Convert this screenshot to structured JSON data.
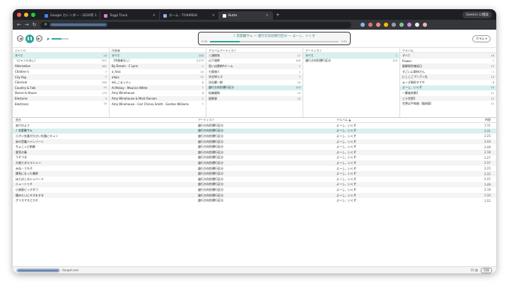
{
  "tabs": [
    {
      "label": "Google カレンダー - 2026年 1",
      "color": "#4285f4",
      "active": false
    },
    {
      "label": "Toggl Track",
      "color": "#e57cd8",
      "active": false
    },
    {
      "label": "ホーム - TOKIMEKI",
      "color": "#8ab4f8",
      "active": false
    },
    {
      "label": "Butte",
      "color": "#ffffff",
      "active": true
    }
  ],
  "profile": "Gemini に相談",
  "player": {
    "now_playing": "♪ 恋愛離サム ー 盛行方向別運行区分 ー よーし、いくぞ",
    "elapsed": "0:35",
    "duration": "2:31",
    "progress": 0.23,
    "volume": 0.6,
    "column_button": "カラム ▾"
  },
  "panes": [
    {
      "header": "ジャンル",
      "items": [
        {
          "label": "すべて",
          "count": "24",
          "sel": true
        },
        {
          "label": "（ジャンルなし）",
          "count": "501"
        },
        {
          "label": "Alternative",
          "count": "281"
        },
        {
          "label": "Children's",
          "count": "7"
        },
        {
          "label": "City Pop",
          "count": "1"
        },
        {
          "label": "Classical",
          "count": "290"
        },
        {
          "label": "Country & Folk",
          "count": "11"
        },
        {
          "label": "Dance & House",
          "count": "173"
        },
        {
          "label": "Electonic",
          "count": "9"
        },
        {
          "label": "Electronic",
          "count": "19"
        }
      ]
    },
    {
      "header": "作曲者",
      "items": [
        {
          "label": "すべて",
          "count": "285",
          "sel": true
        },
        {
          "label": "（作曲者なし）",
          "count": "3,279"
        },
        {
          "label": "By Dream - C Lynn",
          "count": "1"
        },
        {
          "label": "a_hisa",
          "count": "10"
        },
        {
          "label": "a%ks",
          "count": "12"
        },
        {
          "label": "aki_こまっティ",
          "count": "6"
        },
        {
          "label": "Al Mckay - Maurice White",
          "count": "1"
        },
        {
          "label": "Amy Winehouse",
          "count": "8"
        },
        {
          "label": "Amy Winehouse & Mark Ronson",
          "count": "1"
        },
        {
          "label": "Amy Winehouse - Carl Chinna Smith - Gordon Williams",
          "count": "1"
        }
      ]
    },
    {
      "header": "アルバムアーティスト",
      "items": [
        {
          "label": "三浦徳和",
          "count": "17"
        },
        {
          "label": "山下達郎",
          "count": "146"
        },
        {
          "label": "思い出野郎Aチーム",
          "count": "1"
        },
        {
          "label": "七尾旅人",
          "count": "1"
        },
        {
          "label": "渋谷知らズ",
          "count": "7"
        },
        {
          "label": "渋谷慶一郎",
          "count": "14"
        },
        {
          "label": "盛行方向別運行区分",
          "count": "124",
          "sel": true
        },
        {
          "label": "松森優和",
          "count": "14"
        },
        {
          "label": "星野源",
          "count": "15"
        }
      ]
    },
    {
      "header": "アーティスト",
      "items": [
        {
          "label": "すべて",
          "count": "1",
          "sel": true
        },
        {
          "label": "盛行方向別運行区分",
          "count": "124"
        }
      ]
    },
    {
      "header": "アルバム",
      "items": [
        {
          "label": "すべて",
          "count": "18"
        },
        {
          "label": "Flower",
          "count": "1"
        },
        {
          "label": "駅解釈性確認日",
          "count": "17"
        },
        {
          "label": "すごいよ群材さん",
          "count": "1"
        },
        {
          "label": "にここごプンプン丸",
          "count": "14"
        },
        {
          "label": "ムーズ現好きでや",
          "count": "8"
        },
        {
          "label": "よーし、いくぞ",
          "count": "15",
          "sel": true
        },
        {
          "label": "一慶者失敗2",
          "count": "11"
        },
        {
          "label": "三十世界2",
          "count": "11"
        },
        {
          "label": "世界は平和曲（復刻版）",
          "count": "11"
        }
      ]
    }
  ],
  "track_headers": {
    "title": "曲名",
    "artist": "アーティスト",
    "album": "アルバム ▲",
    "time": "時間"
  },
  "tracks": [
    {
      "title": "あけのよう",
      "artist": "盛行方向別運行区分",
      "album": "よーし、いくぞ",
      "time": "1:11"
    },
    {
      "title": "♪ 恋愛離サム",
      "artist": "盛行方向別運行区分",
      "album": "よーし、いくぞ",
      "time": "2:31",
      "sel": true
    },
    {
      "title": "小さい先輩が大きい先輩にキュン",
      "artist": "盛行方向別運行区分",
      "album": "よーし、いくぞ",
      "time": "2:25"
    },
    {
      "title": "氷の音艦ハイレゾーン",
      "artist": "盛行方向別運行区分",
      "album": "よーし、いくぞ",
      "time": "3:44"
    },
    {
      "title": "ちょこっと結婚",
      "artist": "盛行方向別運行区分",
      "album": "よーし、いくぞ",
      "time": "2:49"
    },
    {
      "title": "愛死の春",
      "artist": "盛行方向別運行区分",
      "album": "よーし、いくぞ",
      "time": "2:18"
    },
    {
      "title": "うそつき",
      "artist": "盛行方向別運行区分",
      "album": "よーし、いくぞ",
      "time": "1:27"
    },
    {
      "title": "大袈りダルマニャン",
      "artist": "盛行方向別運行区分",
      "album": "よーし、いくぞ",
      "time": "2:37"
    },
    {
      "title": "みね・うち子",
      "artist": "盛行方向別運行区分",
      "album": "よーし、いくぞ",
      "time": "2:25"
    },
    {
      "title": "課長になった亀郎",
      "artist": "盛行方向別運行区分",
      "album": "よーし、いくぞ",
      "time": "2:35"
    },
    {
      "title": "ほとばしるシュバード",
      "artist": "盛行方向別運行区分",
      "album": "よーし、いくぞ",
      "time": "2:25"
    },
    {
      "title": "ニュートリチ",
      "artist": "盛行方向別運行区分",
      "album": "よーし、いくぞ",
      "time": "1:49"
    },
    {
      "title": "小惑星ビッグダブ",
      "artist": "盛行方向別運行区分",
      "album": "よーし、いくぞ",
      "time": "2:19"
    },
    {
      "title": "鏡みたいにキスをする",
      "artist": "盛行方向別運行区分",
      "album": "よーし、いくぞ",
      "time": "1:34"
    },
    {
      "title": "グリスマスとカネ",
      "artist": "盛行方向別運行区分",
      "album": "よーし、いくぞ",
      "time": "1:52"
    }
  ],
  "status": {
    "host": "/target.com",
    "count": "15 曲",
    "button": "切換"
  }
}
